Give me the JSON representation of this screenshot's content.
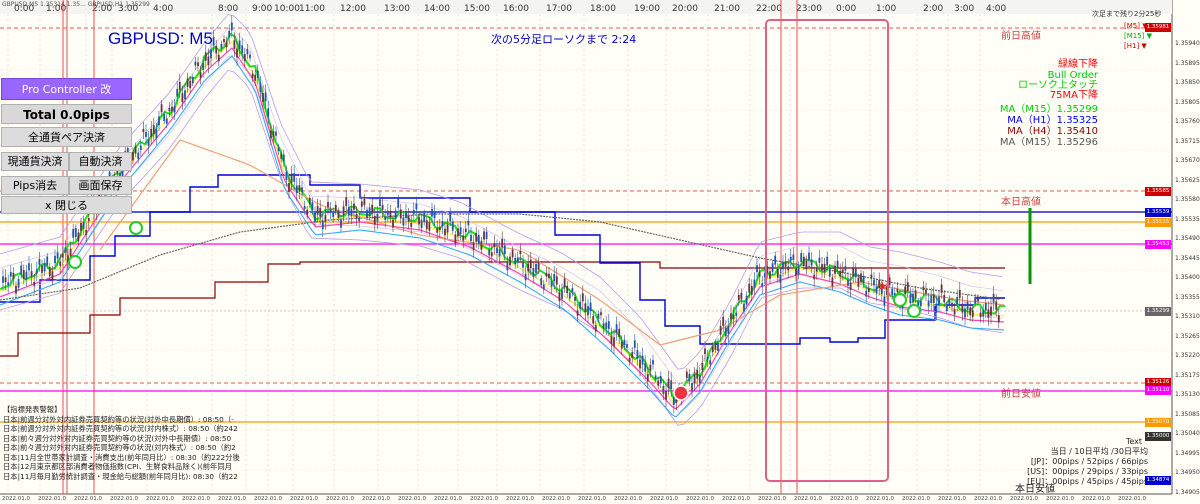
{
  "chart": {
    "symbol_label": "GBPUSD: M5",
    "countdown": "次の5分足ローソクまで 2:24",
    "bar_remaining": "次足まで残り2分25秒",
    "top_timeline": [
      "0:00",
      "1:00",
      "2:00",
      "3:00",
      "4:00",
      "8:00",
      "9:00",
      "10:00",
      "11:00",
      "12:00",
      "13:00",
      "14:00",
      "15:00",
      "16:00",
      "17:00",
      "18:00",
      "19:00",
      "20:00",
      "21:00",
      "22:00",
      "23:00",
      "0:00",
      "1:00",
      "2:00",
      "3:00",
      "4:00"
    ],
    "top_small_text": "GBPUSD,M5 1.35314 1.35... GBPUSD,H1 1.35299",
    "x_axis_labels": [
      "2022.01.0",
      "2022.01.0",
      "2022.01.0",
      "2022.01.0",
      "2022.01.0",
      "2022.01.0",
      "2022.01.0",
      "2022.01.0",
      "2022.01.0",
      "2022.01.0",
      "2022.01.0",
      "2022.01.0",
      "2022.01.0",
      "2022.01.0",
      "2022.01.0",
      "2022.01.0",
      "2022.01.0",
      "2022.01.0",
      "2022.01.0",
      "2022.01.0",
      "2022.01.0",
      "2022.01.0",
      "2022.01.0",
      "2022.01.0",
      "2022.01.0",
      "2022.01.0",
      "2022.01.0",
      "2022.01.0",
      "2022.01.0",
      "2022.01.0",
      "2022.01.0",
      "2022.01.0"
    ],
    "y_axis_labels": [
      "1.35940",
      "1.35895",
      "1.35850",
      "1.35805",
      "1.35760",
      "1.35715",
      "1.35670",
      "1.35625",
      "1.35580",
      "1.35535",
      "1.35490",
      "1.35445",
      "1.35400",
      "1.35355",
      "1.35310",
      "1.35265",
      "1.35220",
      "1.35175",
      "1.35130",
      "1.35085",
      "1.35040",
      "1.34995",
      "1.34950",
      "1.34905"
    ],
    "price_tags": [
      {
        "text": "1.35981",
        "color": "#cc0000"
      },
      {
        "text": "1.35585",
        "color": "#cc0000"
      },
      {
        "text": "1.35539",
        "color": "#0000cc"
      },
      {
        "text": "1.35515",
        "color": "#ff9900"
      },
      {
        "text": "1.35453",
        "color": "#ff00ff"
      },
      {
        "text": "1.35299",
        "color": "#666666"
      },
      {
        "text": "1.35126",
        "color": "#cc0000"
      },
      {
        "text": "1.35110",
        "color": "#ff00ff"
      },
      {
        "text": "1.35070",
        "color": "#ff9900"
      },
      {
        "text": "1.35000",
        "color": "#333333"
      },
      {
        "text": "1.34874",
        "color": "#0000cc"
      }
    ],
    "line_labels": {
      "prev_high": "前日高値",
      "today_high": "本日高値",
      "prev_low": "前日安値",
      "today_low": "本日安値"
    },
    "tf_trend": [
      {
        "tf": "[M5]",
        "color": "#cc0000"
      },
      {
        "tf": "[M15]",
        "color": "#00aa00"
      },
      {
        "tf": "[H1]",
        "color": "#cc0000"
      }
    ],
    "indicators": [
      {
        "text": "緑線下降",
        "color": "#ff0000"
      },
      {
        "text": "Bull Order",
        "color": "#00cc00"
      },
      {
        "text": "ローソク上タッチ",
        "color": "#00cc00"
      },
      {
        "text": "75MA下降",
        "color": "#ff0000"
      }
    ],
    "ma_values": [
      {
        "text": "MA（M15）1.35299",
        "color": "#00cc00"
      },
      {
        "text": "MA（H1）1.35325",
        "color": "#0000ff"
      },
      {
        "text": "MA（H4）1.35410",
        "color": "#8b0000"
      },
      {
        "text": "MA（M15）1.35296",
        "color": "#555555"
      }
    ],
    "news_title": "【指標発表警報】",
    "news_items": [
      "日本|前週分対外対内証券売買契約等の状況(対外中長期債）: 08:50（-",
      "日本|前週分対外対内証券売買契約等の状況(対内株式）: 08:50（約242",
      "日本|前々週分対外対内証券売買契約等の状況(対外中長期債）: 08:50",
      "日本|前々週分対外対内証券売買契約等の状況(対内株式）: 08:50（約2",
      "日本|11月全世帯家計調査・消費支出(前年同月比）: 08:30（約222分後",
      "日本|12月東京都区部消費者物価指数(CPI、生鮮食料品除く)(前年同月",
      "日本|11月毎月勤労統計調査・現金給与総額(前年同月比): 08:30（約22"
    ],
    "stats": {
      "title": "Text",
      "header": "当日 / 10日平均 /30日平均",
      "jp": "[JP]：00pips / 52pips / 66pips",
      "us": "[US]：00pips / 29pips / 33pips",
      "eu": "[EU]：00pips / 45pips / 45pips"
    }
  },
  "controller": {
    "title": "Pro Controller 改",
    "total": "Total   0.0pips",
    "close_all": "全通貨ペア決済",
    "close_current": "現通貨決済",
    "auto_close": "自動決済",
    "clear_pips": "Pips消去",
    "save_screen": "画面保存",
    "close": "x 閉じる"
  },
  "colors": {
    "bg": "#fffff8",
    "controller_title_bg": "#9966ff",
    "highlight_box": "#e0608a"
  }
}
